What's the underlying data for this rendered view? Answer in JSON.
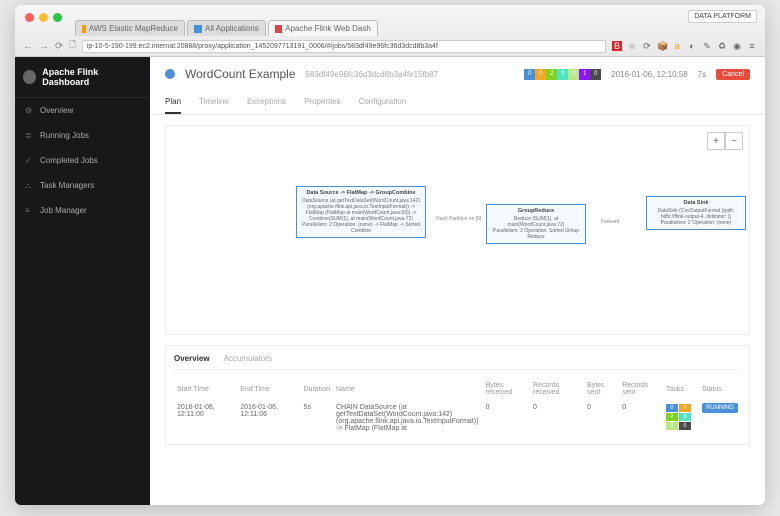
{
  "chrome": {
    "tabs": [
      {
        "label": "AWS Elastic MapReduce"
      },
      {
        "label": "All Applications"
      },
      {
        "label": "Apache Flink Web Dash"
      }
    ],
    "url": "ip-10-5-190-199.ec2.internal:20888/proxy/application_1452097713191_0006/#/jobs/583df49e96fc36d3dcd8b3a4f",
    "platform": "DATA PLATFORM"
  },
  "sidebar": {
    "brand": "Apache Flink Dashboard",
    "items": [
      {
        "label": "Overview"
      },
      {
        "label": "Running Jobs"
      },
      {
        "label": "Completed Jobs"
      },
      {
        "label": "Task Managers"
      },
      {
        "label": "Job Manager"
      }
    ]
  },
  "job": {
    "name": "WordCount Example",
    "id": "583df49e96fc36d3dcd8b3a4fe15fb87",
    "badges": [
      "0",
      "0",
      "2",
      "0",
      "0",
      "1",
      "0"
    ],
    "timestamp": "2016-01-06, 12:10:58",
    "duration": "7s",
    "cancel": "Cancel"
  },
  "subtabs": [
    "Plan",
    "Timeline",
    "Exceptions",
    "Properties",
    "Configuration"
  ],
  "nodes": {
    "n1": {
      "title": "Data Source -> FlatMap -> GroupCombine",
      "body": "DataSource (at getTextDataSet(WordCount.java:142) (org.apache.flink.api.java.io.TextInputFormat))\n-> FlatMap (FlatMap at main(WordCount.java:69))\n-> Combine(SUM(1), at main(WordCount.java:72)",
      "meta": "Parallelism: 2\nOperation: (none)\n-> FlatMap\n-> Sorted Combine"
    },
    "n2": {
      "title": "GroupReduce",
      "body": "Reduce (SUM(1), at main(WordCount.java:72)",
      "meta": "Parallelism: 2\nOperation: Sorted Group Reduce"
    },
    "n3": {
      "title": "Data Sink",
      "body": "DataSink (CsvOutputFormat (path: hdfs://flink-output-4, delimiter: ))",
      "meta": "Parallelism: 2\nOperation: (none)"
    },
    "edge1": "Hash Partition on [0]",
    "edge2": "Forward"
  },
  "detail": {
    "tabs": [
      "Overview",
      "Accumulators"
    ],
    "headers": [
      "Start Time",
      "End Time",
      "Duration",
      "Name",
      "Bytes received",
      "Records received",
      "Bytes sent",
      "Records sent",
      "Tasks",
      "Status"
    ],
    "row": {
      "start": "2016-01-06, 12:11:00",
      "end": "2016-01-06, 12:11:06",
      "dur": "5s",
      "name": "CHAIN DataSource (at getTextDataSet(WordCount.java:142) (org.apache.flink.api.java.io.TextInputFormat)) -> FlatMap (FlatMap at",
      "brecv": "0",
      "rrecv": "0",
      "bsent": "0",
      "rsent": "0",
      "tasks": [
        "0",
        "0",
        "2",
        "0",
        "0",
        "0"
      ],
      "status": "RUNNING"
    }
  }
}
